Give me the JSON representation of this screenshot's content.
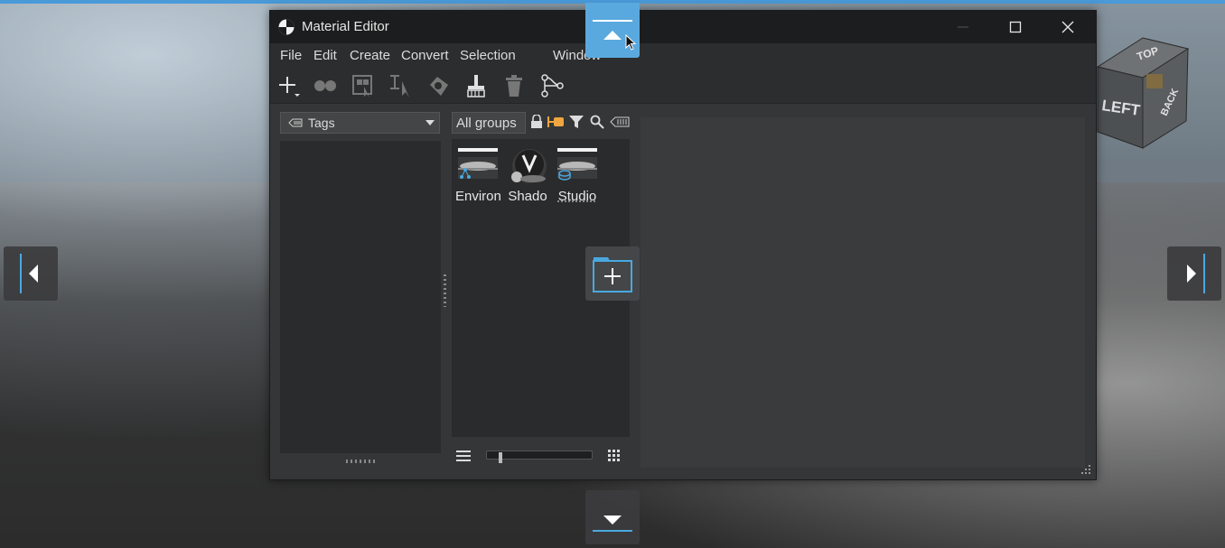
{
  "window": {
    "title": "Material Editor",
    "controls": [
      "minimize",
      "maximize",
      "close"
    ]
  },
  "menu": [
    "File",
    "Edit",
    "Create",
    "Convert",
    "Selection",
    "Window"
  ],
  "toolbar": {
    "icons": [
      "add-material-icon",
      "merge-icon",
      "select-icon",
      "pick-icon",
      "apply-icon",
      "cleanup-icon",
      "delete-icon",
      "graph-icon"
    ]
  },
  "tags": {
    "dropdown_label": "Tags"
  },
  "groups": {
    "dropdown_label": "All groups"
  },
  "materials": [
    {
      "label": "Environ",
      "title": "Environment"
    },
    {
      "label": "Shado",
      "title": "Shadow"
    },
    {
      "label": "Studio",
      "title": "Studio"
    }
  ],
  "viewcube": {
    "top": "TOP",
    "left": "LEFT",
    "back": "BACK"
  },
  "colors": {
    "accent": "#5aa9de",
    "window_bg": "#353637",
    "titlebar": "#1c1d1e"
  },
  "thumbnail_size": 0.12
}
